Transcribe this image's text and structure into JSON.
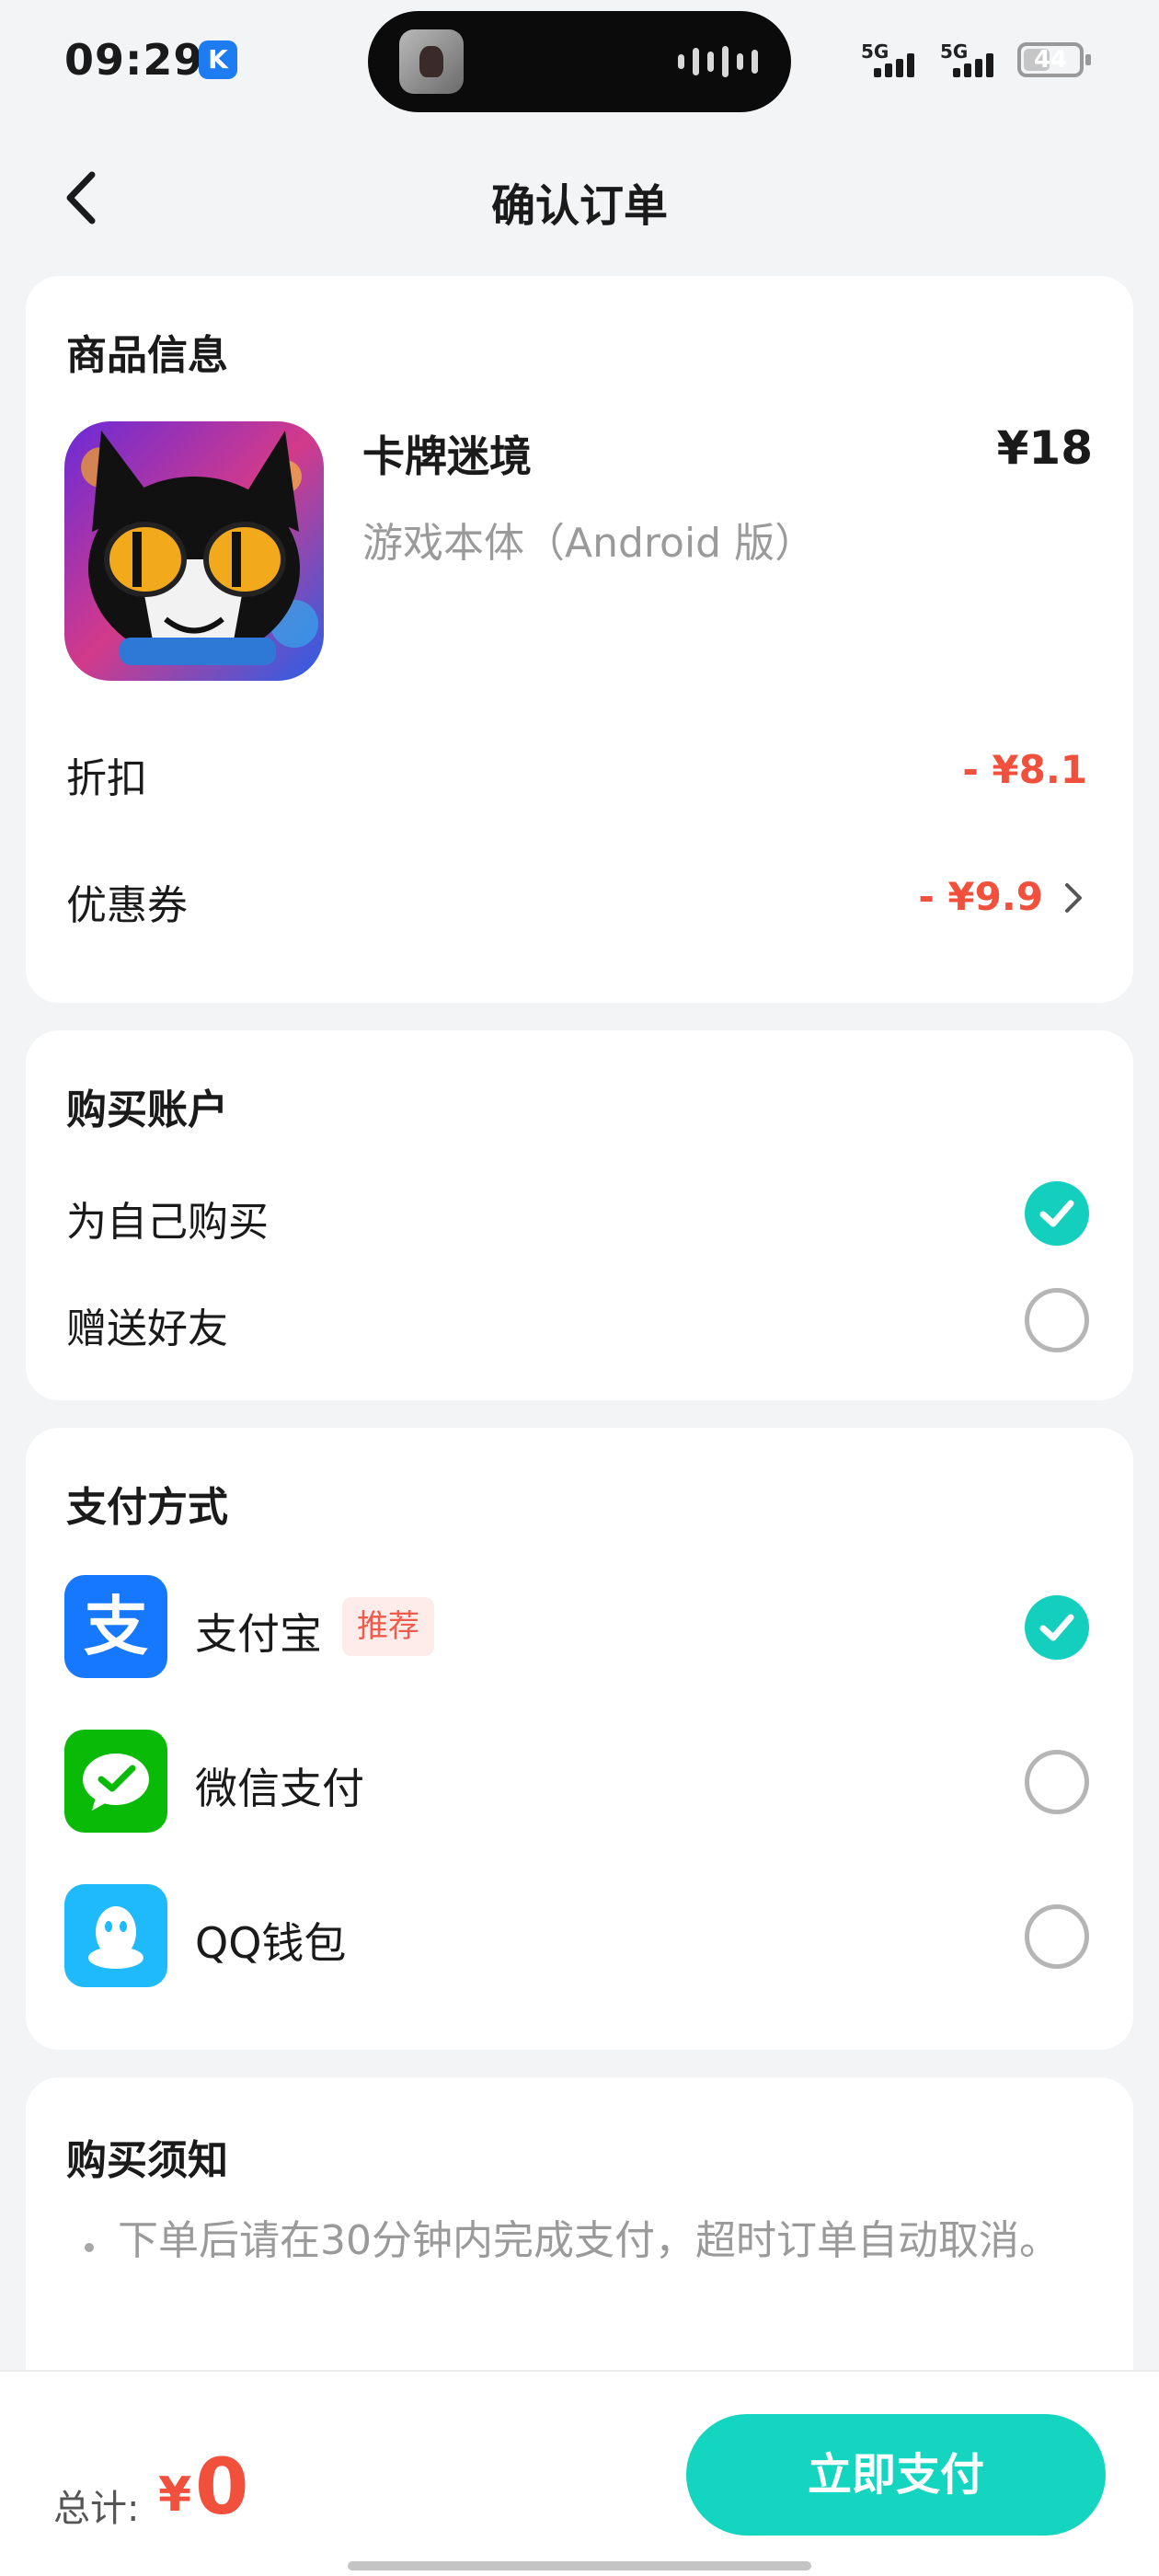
{
  "status_bar": {
    "time": "09:29",
    "badge_letter": "K",
    "sim1_label": "5G",
    "sim2_label": "5G",
    "battery_level": "44"
  },
  "header": {
    "title": "确认订单",
    "back_icon": "chevron-left-icon"
  },
  "product": {
    "section_title": "商品信息",
    "name": "卡牌迷境",
    "price": "¥18",
    "subtitle": "游戏本体（Android 版）",
    "discount_label": "折扣",
    "discount_value": "- ¥8.1",
    "coupon_label": "优惠券",
    "coupon_value": "- ¥9.9"
  },
  "account": {
    "section_title": "购买账户",
    "options": [
      {
        "label": "为自己购买",
        "selected": true
      },
      {
        "label": "赠送好友",
        "selected": false
      }
    ]
  },
  "payment": {
    "section_title": "支付方式",
    "methods": [
      {
        "label": "支付宝",
        "tag": "推荐",
        "icon": "alipay-icon",
        "color": "#1677ff",
        "selected": true
      },
      {
        "label": "微信支付",
        "icon": "wechat-pay-icon",
        "color": "#09bb07",
        "selected": false
      },
      {
        "label": "QQ钱包",
        "icon": "qq-wallet-icon",
        "color": "#1ebafc",
        "selected": false
      }
    ]
  },
  "notice": {
    "section_title": "购买须知",
    "items": [
      "下单后请在30分钟内完成支付，超时订单自动取消。"
    ]
  },
  "footer": {
    "total_label": "总计:",
    "currency": "¥",
    "total_amount": "0",
    "pay_button": "立即支付"
  },
  "colors": {
    "accent": "#14d5c0",
    "price_red": "#f0503c",
    "background": "#f3f4f6"
  }
}
